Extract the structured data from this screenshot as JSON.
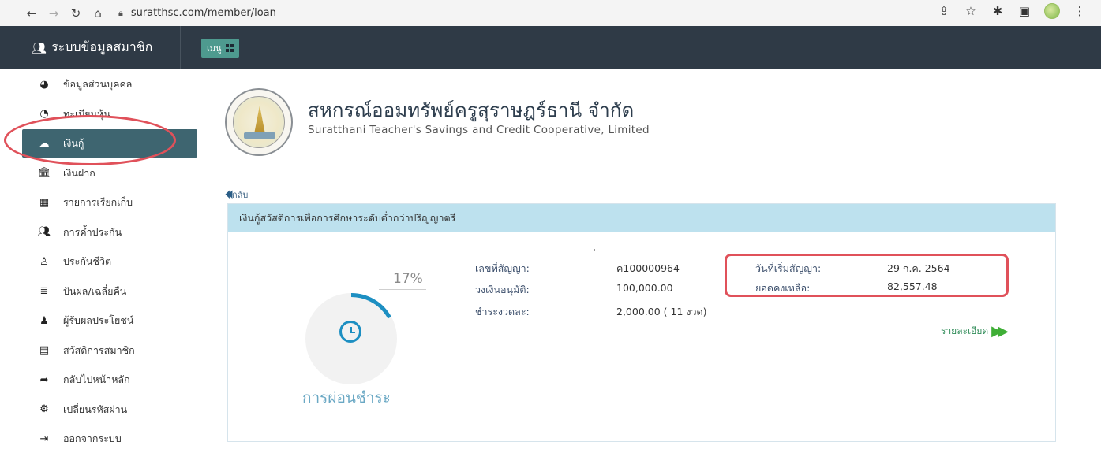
{
  "browser": {
    "url": "suratthsc.com/member/loan"
  },
  "app": {
    "brand": "ระบบข้อมูลสมาชิก",
    "menu_label": "เมนู"
  },
  "sidebar": {
    "items": [
      {
        "label": "ข้อมูลส่วนบุคคล",
        "icon": "dashboard-icon"
      },
      {
        "label": "ทะเบียนหุ้น",
        "icon": "pie-chart-icon"
      },
      {
        "label": "เงินกู้",
        "icon": "cloud-upload-icon",
        "active": true
      },
      {
        "label": "เงินฝาก",
        "icon": "bank-icon"
      },
      {
        "label": "รายการเรียกเก็บ",
        "icon": "calendar-icon"
      },
      {
        "label": "การค้ำประกัน",
        "icon": "users-icon"
      },
      {
        "label": "ประกันชีวิต",
        "icon": "person-icon"
      },
      {
        "label": "ปันผล/เฉลี่ยคืน",
        "icon": "database-icon"
      },
      {
        "label": "ผู้รับผลประโยชน์",
        "icon": "user-icon"
      },
      {
        "label": "สวัสดิการสมาชิก",
        "icon": "calculator-icon"
      },
      {
        "label": "กลับไปหน้าหลัก",
        "icon": "share-arrow-icon"
      },
      {
        "label": "เปลี่ยนรหัสผ่าน",
        "icon": "cogs-icon"
      },
      {
        "label": "ออกจากระบบ",
        "icon": "sign-out-icon"
      }
    ]
  },
  "header": {
    "title_th": "สหกรณ์ออมทรัพย์ครูสุราษฎร์ธานี จำกัด",
    "title_en": "Suratthani Teacher's Savings and Credit Cooperative, Limited"
  },
  "back_label": "กลับ",
  "loan": {
    "name": "เงินกู้สวัสดิการเพื่อการศึกษาระดับต่ำกว่าปริญญาตรี",
    "progress_percent": 17,
    "progress_text": "17%",
    "repay_label": "การผ่อนชำระ",
    "contract_no_label": "เลขที่สัญญา:",
    "contract_no": "ค100000964",
    "approved_label": "วงเงินอนุมัติ:",
    "approved": "100,000.00",
    "installment_label": "ชำระงวดละ:",
    "installment": "2,000.00 ( 11 งวด)",
    "start_date_label": "วันที่เริ่มสัญญา:",
    "start_date": "29 ก.ค. 2564",
    "balance_label": "ยอดคงเหลือ:",
    "balance": "82,557.48",
    "detail_label": "รายละเอียด"
  },
  "colors": {
    "appbar": "#2f3a46",
    "sidebar_active": "#3e6570",
    "card_header": "#bde1ee",
    "highlight_annotation": "#e0515a",
    "accent_blue": "#1d8fc2",
    "detail_green": "#3fae36"
  }
}
